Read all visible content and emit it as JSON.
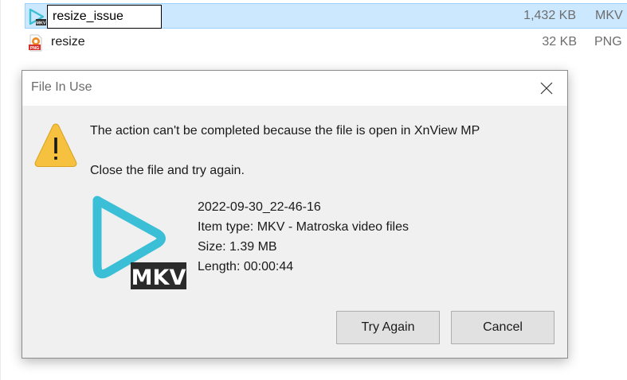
{
  "files": [
    {
      "name": "resize_issue",
      "size": "1,432 KB",
      "type": "MKV",
      "icon": "mkv-file-icon",
      "selected": true,
      "renaming": true
    },
    {
      "name": "resize",
      "size": "32 KB",
      "type": "PNG",
      "icon": "png-file-icon",
      "selected": false,
      "renaming": false
    }
  ],
  "dialog": {
    "title": "File In Use",
    "message": "The action can't be completed because the file is open in XnView MP",
    "submessage": "Close the file and try again.",
    "icon": "warning-icon",
    "file_thumb_label": "MKV",
    "details": {
      "name": "2022-09-30_22-46-16",
      "item_type": "Item type: MKV - Matroska video files",
      "size": "Size: 1.39 MB",
      "length": "Length: 00:00:44"
    },
    "buttons": {
      "try_again": "Try Again",
      "cancel": "Cancel"
    }
  },
  "colors": {
    "selection": "#cce8ff",
    "mkv_accent": "#3bbfd6",
    "warning": "#f5c13e",
    "png_red": "#d9312b"
  }
}
